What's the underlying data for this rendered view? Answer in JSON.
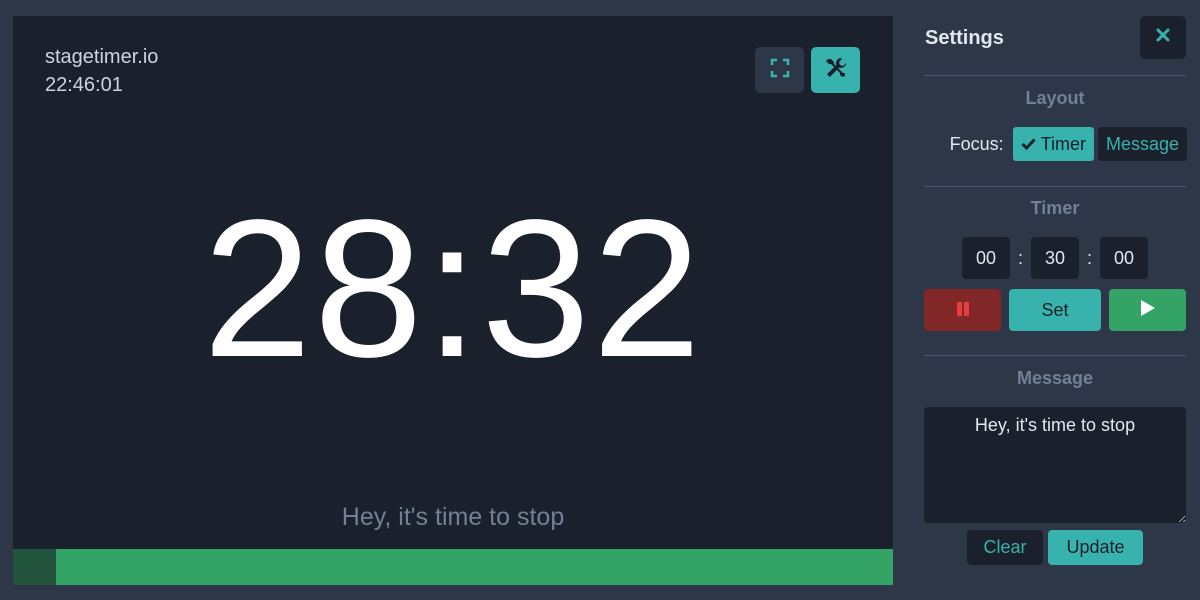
{
  "stage": {
    "brand": "stagetimer.io",
    "clock": "22:46:01",
    "timer_display": "28:32",
    "message": "Hey, it's time to stop",
    "progress_remaining_pct": 95.1,
    "buttons": {
      "fullscreen_icon": "fullscreen-icon",
      "tools_icon": "wrench-screwdriver-icon"
    }
  },
  "settings": {
    "title": "Settings",
    "close_icon": "close-icon",
    "layout": {
      "heading": "Layout",
      "focus_label": "Focus:",
      "options": [
        {
          "label": "Timer",
          "selected": true
        },
        {
          "label": "Message",
          "selected": false
        }
      ]
    },
    "timer": {
      "heading": "Timer",
      "hours": "00",
      "minutes": "30",
      "seconds": "00",
      "separator": ":",
      "set_label": "Set",
      "pause_icon": "pause-icon",
      "play_icon": "play-icon"
    },
    "message": {
      "heading": "Message",
      "value": "Hey, it's time to stop",
      "clear_label": "Clear",
      "update_label": "Update"
    }
  },
  "colors": {
    "accent": "#38b2ac",
    "success": "#33a366",
    "danger": "#822727",
    "stage_bg": "#1a202c",
    "panel_bg": "#2d3748"
  }
}
